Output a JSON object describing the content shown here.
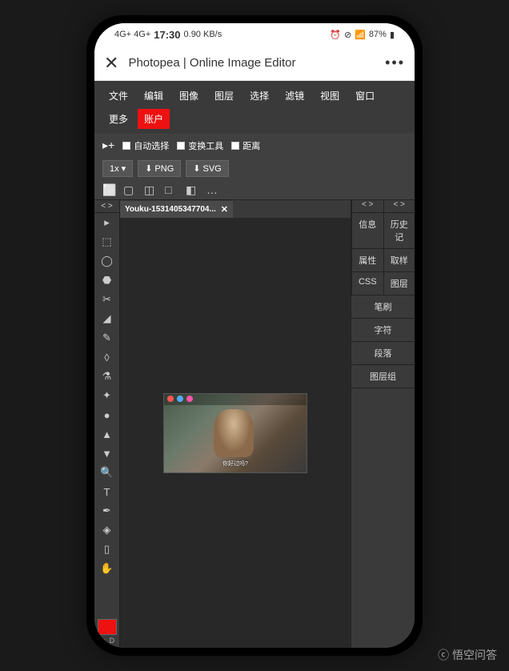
{
  "status_bar": {
    "signal": "4G+ 4G+",
    "time": "17:30",
    "speed": "0.90 KB/s",
    "battery": "87%"
  },
  "app_header": {
    "close": "✕",
    "title": "Photopea | Online Image Editor",
    "more": "•••"
  },
  "menu": {
    "items": [
      {
        "label": "文件",
        "active": false
      },
      {
        "label": "编辑",
        "active": false
      },
      {
        "label": "图像",
        "active": false
      },
      {
        "label": "图层",
        "active": false
      },
      {
        "label": "选择",
        "active": false
      },
      {
        "label": "滤镜",
        "active": false
      },
      {
        "label": "视图",
        "active": false
      },
      {
        "label": "窗口",
        "active": false
      },
      {
        "label": "更多",
        "active": false
      },
      {
        "label": "账户",
        "active": true
      }
    ]
  },
  "options": {
    "move_icon": "▸+",
    "auto_select": "自动选择",
    "transform_tool": "变换工具",
    "distance": "距离"
  },
  "export": {
    "zoom": "1x ▾",
    "png": "PNG",
    "svg": "SVG",
    "download_icon": "⬇"
  },
  "align_icons": [
    "⬜",
    "▢",
    "◫",
    "□",
    "◧",
    "…"
  ],
  "tools": {
    "collapse": "< >",
    "items": [
      "▸",
      "⬚",
      "◯",
      "⬣",
      "✂",
      "◢",
      "✎",
      "◊",
      "⚗",
      "✦",
      "●",
      "▲",
      "▼",
      "🔍",
      "T",
      "✒",
      "◈",
      "▯",
      "✋"
    ],
    "swatch_fg": "#ee1111",
    "swatch_labels": [
      "↑↓",
      "D"
    ]
  },
  "file_tab": {
    "name": "Youku-1531405347704...",
    "close": "✕"
  },
  "canvas": {
    "caption": "你好过吗?"
  },
  "right_panels": {
    "collapse": "< >",
    "groups": [
      [
        {
          "label": "信息"
        },
        {
          "label": "历史记"
        }
      ],
      [
        {
          "label": "属性"
        },
        {
          "label": "取样"
        }
      ],
      [
        {
          "label": "CSS"
        },
        {
          "label": "图层"
        }
      ],
      [
        {
          "label": "笔刷"
        }
      ],
      [
        {
          "label": "字符"
        }
      ],
      [
        {
          "label": "段落"
        }
      ],
      [
        {
          "label": "图层组"
        }
      ]
    ]
  },
  "watermark": "ⓒ 悟空问答"
}
